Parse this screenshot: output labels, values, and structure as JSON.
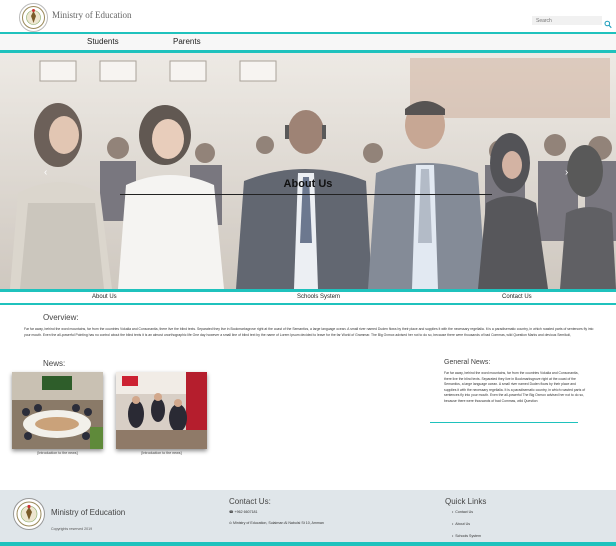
{
  "header": {
    "site_title": "Ministry of Education",
    "search_placeholder": "Search"
  },
  "nav": {
    "students": "Students",
    "parents": "Parents"
  },
  "hero": {
    "title": "About Us",
    "prev_arrow": "‹",
    "next_arrow": "›"
  },
  "links_row": {
    "about": "About Us",
    "schools": "Schools System",
    "contact": "Contact Us"
  },
  "overview": {
    "title": "Overview:",
    "text": "Far far away, behind the word mountains, far from the countries Vokalia and Consonantia, there live the blind texts. Separated they live in Bookmarksgrove right at the coast of the Semantics, a large language ocean. A small river named Duden flows by their place and supplies it with the necessary regelialia. It is a paradisematic country, in which roasted parts of sentences fly into your mouth. Even the all-powerful Pointing has no control about the blind texts it is an almost unorthographic life One day however a small line of blind text by the name of Lorem Ipsum decided to leave for the far World of Grammar. The Big Oxmox advised her not to do so, because there were thousands of bad Commas, wild Question Marks and devious Semikoli,"
  },
  "news": {
    "title": "News:",
    "items": [
      {
        "caption": "[Introduction to the news]"
      },
      {
        "caption": "[Introduction to the news]"
      }
    ]
  },
  "general_news": {
    "title": "General News:",
    "text": "Far far away, behind the word mountains, far from the countries Vokalia and Consonantia, there live the blind texts. Separated they live in Bookmarksgrove right at the coast of the Semantics, a large language ocean. A small river named Duden flows by their place and supplies it with the necessary regelialia. It is a paradisematic country, in which roasted parts of sentences fly into your mouth. Even the all-powerful The Big Oxmox advised her not to do so, because there were thousands of bad Commas, wild Question"
  },
  "footer": {
    "title": "Ministry of Education",
    "rights": "Copyrights reserved 2019",
    "contact_title": "Contact Us:",
    "phone": "☎ +962 6607181",
    "address": "⊙ Ministry of Education, Sulaiman Al Nabulsi St 10, Amman",
    "quick_title": "Quick Links",
    "quick_links": [
      "Contact Us",
      "About Us",
      "Schools System"
    ]
  },
  "colors": {
    "accent": "#1fc2bd",
    "footer_bg": "#e0e6ea"
  },
  "icons": {
    "logo": "ministry-emblem-icon",
    "search": "search-icon"
  }
}
